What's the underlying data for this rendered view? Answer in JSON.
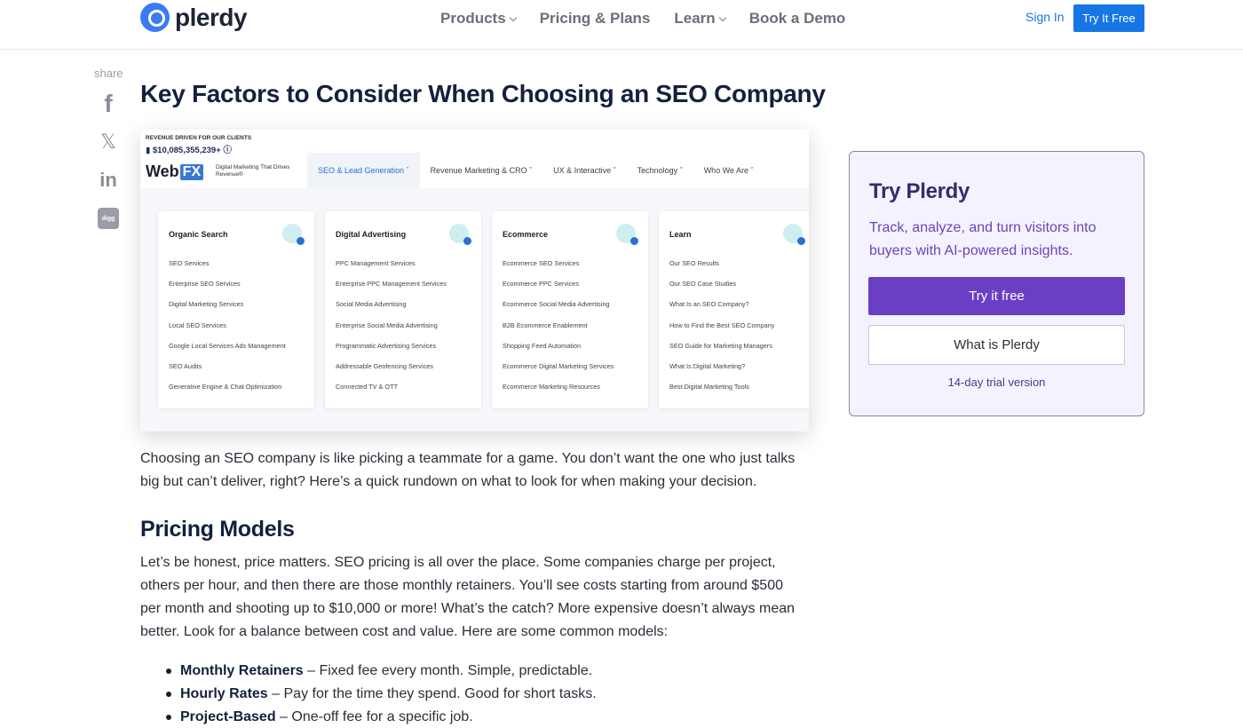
{
  "header": {
    "logo_text": "plerdy",
    "nav": [
      {
        "label": "Products",
        "has_dropdown": true
      },
      {
        "label": "Pricing & Plans",
        "has_dropdown": false
      },
      {
        "label": "Learn",
        "has_dropdown": true
      },
      {
        "label": "Book a Demo",
        "has_dropdown": false
      }
    ],
    "sign_in": "Sign In",
    "try_free": "Try It Free",
    "accent_color": "#1776e6"
  },
  "share": {
    "label": "share",
    "icons": [
      "facebook-icon",
      "x-icon",
      "linkedin-icon",
      "digg-icon"
    ],
    "digg_text": "digg"
  },
  "article": {
    "title": "Key Factors to Consider When Choosing an SEO Company",
    "figure": {
      "revenue_label": "REVENUE DRIVEN FOR OUR CLIENTS",
      "revenue_value": "$10,085,355,239+",
      "brand_web": "Web",
      "brand_fx": "FX",
      "tagline": "Digital Marketing That Drives Revenue®",
      "nav": [
        {
          "label": "SEO & Lead Generation",
          "active": true
        },
        {
          "label": "Revenue Marketing & CRO",
          "active": false
        },
        {
          "label": "UX & Interactive",
          "active": false
        },
        {
          "label": "Technology",
          "active": false
        },
        {
          "label": "Who We Are",
          "active": false
        }
      ],
      "cards": [
        {
          "title": "Organic Search",
          "items": [
            "SEO Services",
            "Enterprise SEO Services",
            "Digital Marketing Services",
            "Local SEO Services",
            "Google Local Services Ads Management",
            "SEO Audits",
            "Generative Engine & Chat Optimization"
          ]
        },
        {
          "title": "Digital Advertising",
          "items": [
            "PPC Management Services",
            "Enterprise PPC Management Services",
            "Social Media Advertising",
            "Enterprise Social Media Advertising",
            "Programmatic Advertising Services",
            "Addressable Geofencing Services",
            "Connected TV & OTT"
          ]
        },
        {
          "title": "Ecommerce",
          "items": [
            "Ecommerce SEO Services",
            "Ecommerce PPC Services",
            "Ecommerce Social Media Advertising",
            "B2B Ecommerce Enablement",
            "Shopping Feed Automation",
            "Ecommerce Digital Marketing Services",
            "Ecommerce Marketing Resources"
          ]
        },
        {
          "title": "Learn",
          "items": [
            "Our SEO Results",
            "Our SEO Case Studies",
            "What Is an SEO Company?",
            "How to Find the Best SEO Company",
            "SEO Guide for Marketing Managers",
            "What Is Digital Marketing?",
            "Best Digital Marketing Tools"
          ]
        }
      ]
    },
    "intro": "Choosing an SEO company is like picking a teammate for a game. You don’t want the one who just talks big but can’t deliver, right? Here’s a quick rundown on what to look for when making your decision.",
    "section_heading": "Pricing Models",
    "section_text": "Let’s be honest, price matters. SEO pricing is all over the place. Some companies charge per project, others per hour, and then there are those monthly retainers. You’ll see costs starting from around $500 per month and shooting up to $10,000 or more! What’s the catch? More expensive doesn’t always mean better. Look for a balance between cost and value. Here are some common models:",
    "bullets": [
      {
        "term": "Monthly Retainers",
        "desc": " – Fixed fee every month. Simple, predictable."
      },
      {
        "term": "Hourly Rates",
        "desc": " – Pay for the time they spend. Good for short tasks."
      },
      {
        "term": "Project-Based",
        "desc": " – One-off fee for a specific job."
      }
    ]
  },
  "promo": {
    "title": "Try Plerdy",
    "description": "Track, analyze, and turn visitors into buyers with AI-powered insights.",
    "primary_button": "Try it free",
    "secondary_button": "What is Plerdy",
    "trial_note": "14-day trial version",
    "accent_color": "#6a3fc4"
  }
}
